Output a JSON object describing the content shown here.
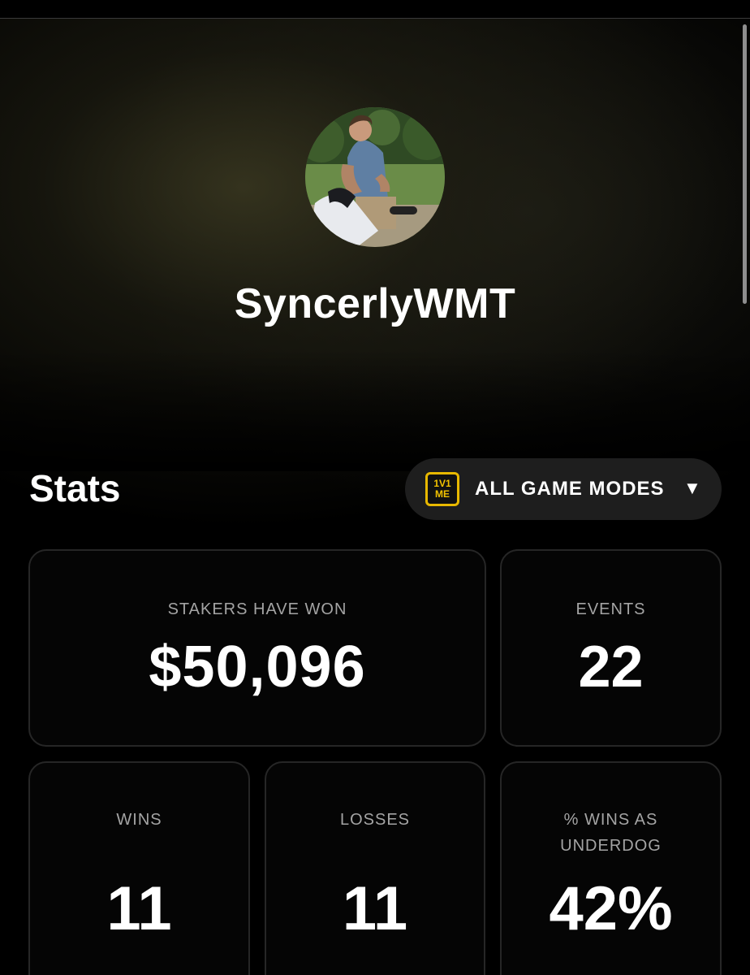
{
  "profile": {
    "username": "SyncerlyWMT"
  },
  "stats": {
    "title": "Stats",
    "mode_selector": {
      "logo_text_top": "1V1",
      "logo_text_bottom": "ME",
      "selected": "ALL GAME MODES",
      "caret": "▼"
    },
    "cards": {
      "stakers_won": {
        "label": "STAKERS HAVE WON",
        "value": "$50,096"
      },
      "events": {
        "label": "EVENTS",
        "value": "22"
      },
      "wins": {
        "label": "WINS",
        "value": "11"
      },
      "losses": {
        "label": "LOSSES",
        "value": "11"
      },
      "underdog": {
        "label_line1": "% WINS AS",
        "label_line2": "UNDERDOG",
        "value": "42%"
      }
    }
  },
  "colors": {
    "background": "#000000",
    "card_border": "#262626",
    "selector_bg": "#1e1e1e",
    "accent_gold": "#e8b800",
    "label_gray": "#a4a4a4"
  }
}
